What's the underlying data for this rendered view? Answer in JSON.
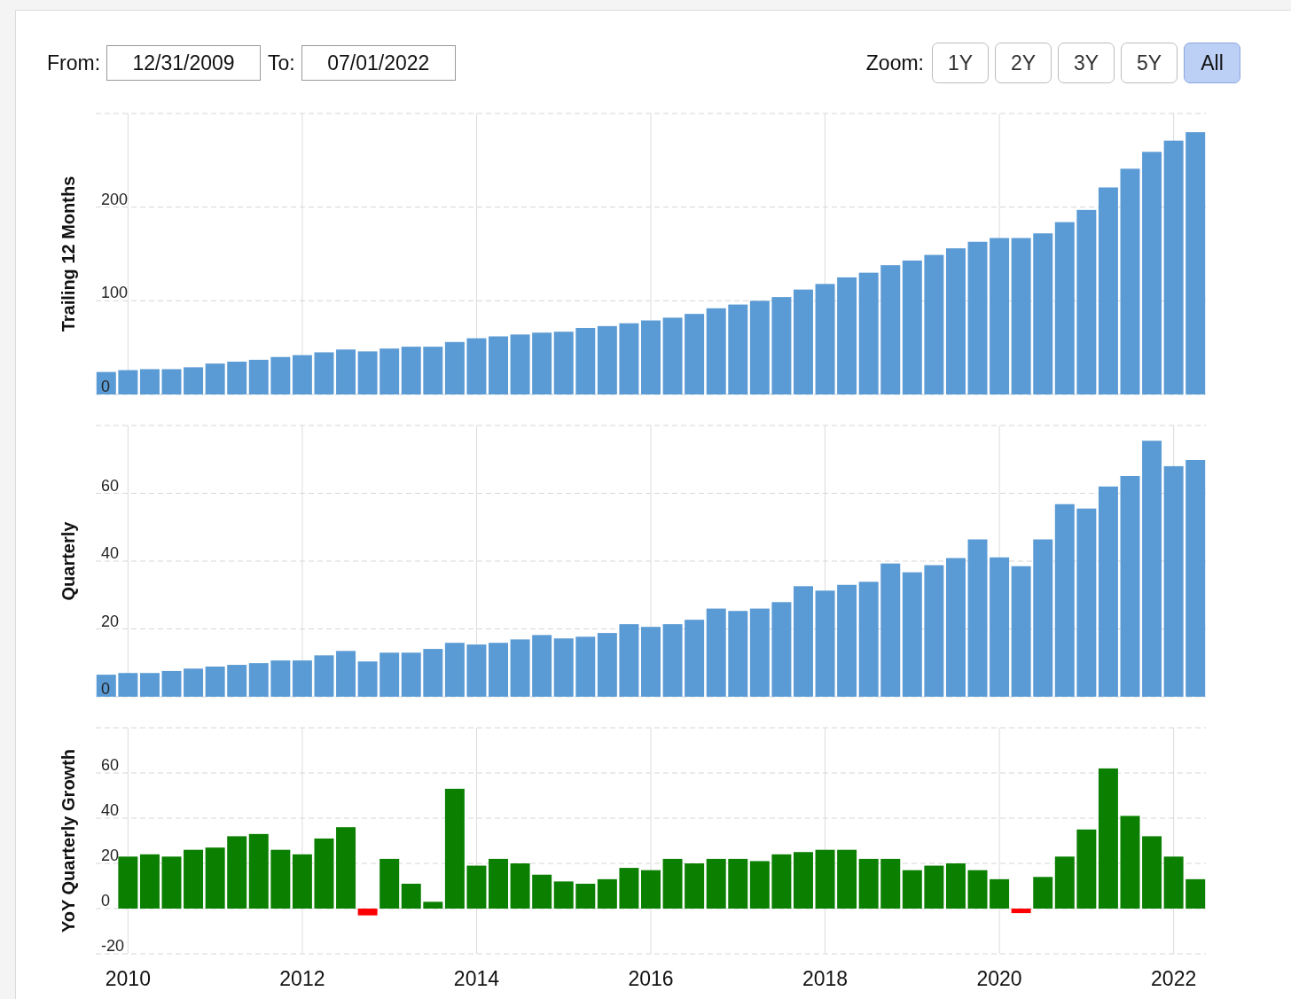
{
  "date_range": {
    "from_label": "From:",
    "from_value": "12/31/2009",
    "to_label": "To:",
    "to_value": "07/01/2022"
  },
  "zoom": {
    "label": "Zoom:",
    "buttons": [
      {
        "label": "1Y",
        "selected": false
      },
      {
        "label": "2Y",
        "selected": false
      },
      {
        "label": "3Y",
        "selected": false
      },
      {
        "label": "5Y",
        "selected": false
      },
      {
        "label": "All",
        "selected": true
      }
    ]
  },
  "charts": [
    {
      "chart_data": {
        "type": "bar",
        "ylabel": "Trailing 12 Months",
        "grid": true,
        "xlim": [
          2009.63,
          2022.37
        ],
        "ylim": [
          0,
          300
        ],
        "yticks": [
          0,
          100,
          200
        ],
        "x": [
          2009.75,
          2010,
          2010.25,
          2010.5,
          2010.75,
          2011,
          2011.25,
          2011.5,
          2011.75,
          2012,
          2012.25,
          2012.5,
          2012.75,
          2013,
          2013.25,
          2013.5,
          2013.75,
          2014,
          2014.25,
          2014.5,
          2014.75,
          2015,
          2015.25,
          2015.5,
          2015.75,
          2016,
          2016.25,
          2016.5,
          2016.75,
          2017,
          2017.25,
          2017.5,
          2017.75,
          2018,
          2018.25,
          2018.5,
          2018.75,
          2019,
          2019.25,
          2019.5,
          2019.75,
          2020,
          2020.25,
          2020.5,
          2020.75,
          2021,
          2021.25,
          2021.5,
          2021.75,
          2022,
          2022.25
        ],
        "series": [
          {
            "color": "#5b9bd5",
            "values": [
              24,
              26,
              27,
              27,
              29,
              33,
              35,
              37,
              40,
              42,
              45,
              48,
              46,
              49,
              51,
              51,
              56,
              60,
              62,
              64,
              66,
              67,
              71,
              73,
              76,
              79,
              82,
              86,
              92,
              96,
              100,
              104,
              112,
              118,
              125,
              130,
              138,
              143,
              149,
              156,
              163,
              167,
              167,
              172,
              184,
              197,
              221,
              241,
              259,
              271,
              280
            ]
          }
        ]
      }
    },
    {
      "chart_data": {
        "type": "bar",
        "ylabel": "Quarterly",
        "grid": true,
        "xlim": [
          2009.63,
          2022.37
        ],
        "ylim": [
          0,
          80
        ],
        "yticks": [
          0,
          20,
          40,
          60
        ],
        "x": [
          2009.75,
          2010,
          2010.25,
          2010.5,
          2010.75,
          2011,
          2011.25,
          2011.5,
          2011.75,
          2012,
          2012.25,
          2012.5,
          2012.75,
          2013,
          2013.25,
          2013.5,
          2013.75,
          2014,
          2014.25,
          2014.5,
          2014.75,
          2015,
          2015.25,
          2015.5,
          2015.75,
          2016,
          2016.25,
          2016.5,
          2016.75,
          2017,
          2017.25,
          2017.5,
          2017.75,
          2018,
          2018.25,
          2018.5,
          2018.75,
          2019,
          2019.25,
          2019.5,
          2019.75,
          2020,
          2020.25,
          2020.5,
          2020.75,
          2021,
          2021.25,
          2021.5,
          2021.75,
          2022,
          2022.25
        ],
        "series": [
          {
            "color": "#5b9bd5",
            "values": [
              6.5,
              7,
              7,
              7.6,
              8.3,
              8.9,
              9.4,
              9.9,
              10.7,
              10.7,
              12.2,
              13.5,
              10.4,
              13,
              13,
              14.1,
              15.9,
              15.4,
              15.9,
              16.9,
              18.2,
              17.2,
              17.7,
              18.8,
              21.4,
              20.6,
              21.4,
              22.7,
              26,
              25.3,
              26,
              27.9,
              32.6,
              31.3,
              33,
              33.9,
              39.3,
              36.7,
              38.8,
              40.9,
              46.4,
              41.1,
              38.5,
              46.4,
              56.8,
              55.5,
              62,
              65.1,
              75.5,
              68,
              69.8
            ]
          }
        ]
      }
    },
    {
      "chart_data": {
        "type": "bar",
        "ylabel": "YoY Quarterly Growth",
        "grid": true,
        "xlim": [
          2009.63,
          2022.37
        ],
        "ylim": [
          -20,
          80
        ],
        "yticks": [
          -20,
          0,
          20,
          40,
          60
        ],
        "xticks": [
          2010,
          2012,
          2014,
          2016,
          2018,
          2020,
          2022
        ],
        "x": [
          2010,
          2010.25,
          2010.5,
          2010.75,
          2011,
          2011.25,
          2011.5,
          2011.75,
          2012,
          2012.25,
          2012.5,
          2012.75,
          2013,
          2013.25,
          2013.5,
          2013.75,
          2014,
          2014.25,
          2014.5,
          2014.75,
          2015,
          2015.25,
          2015.5,
          2015.75,
          2016,
          2016.25,
          2016.5,
          2016.75,
          2017,
          2017.25,
          2017.5,
          2017.75,
          2018,
          2018.25,
          2018.5,
          2018.75,
          2019,
          2019.25,
          2019.5,
          2019.75,
          2020,
          2020.25,
          2020.5,
          2020.75,
          2021,
          2021.25,
          2021.5,
          2021.75,
          2022,
          2022.25
        ],
        "series": [
          {
            "color": "#0a7f00",
            "values": [
              23,
              24,
              23,
              26,
              27,
              32,
              33,
              26,
              24,
              31,
              36,
              null,
              22,
              11,
              3,
              53,
              19,
              22,
              20,
              15,
              12,
              11,
              13,
              18,
              17,
              22,
              20,
              22,
              22,
              21,
              24,
              25,
              26,
              26,
              22,
              22,
              17,
              19,
              20,
              17,
              13,
              null,
              14,
              23,
              35,
              62,
              41,
              32,
              23,
              13
            ]
          },
          {
            "color": "#ff0000",
            "values": [
              null,
              null,
              null,
              null,
              null,
              null,
              null,
              null,
              null,
              null,
              null,
              -3,
              null,
              null,
              null,
              null,
              null,
              null,
              null,
              null,
              null,
              null,
              null,
              null,
              null,
              null,
              null,
              null,
              null,
              null,
              null,
              null,
              null,
              null,
              null,
              null,
              null,
              null,
              null,
              null,
              null,
              -2,
              null,
              null,
              null,
              null,
              null,
              null,
              null,
              null
            ]
          }
        ]
      }
    }
  ]
}
